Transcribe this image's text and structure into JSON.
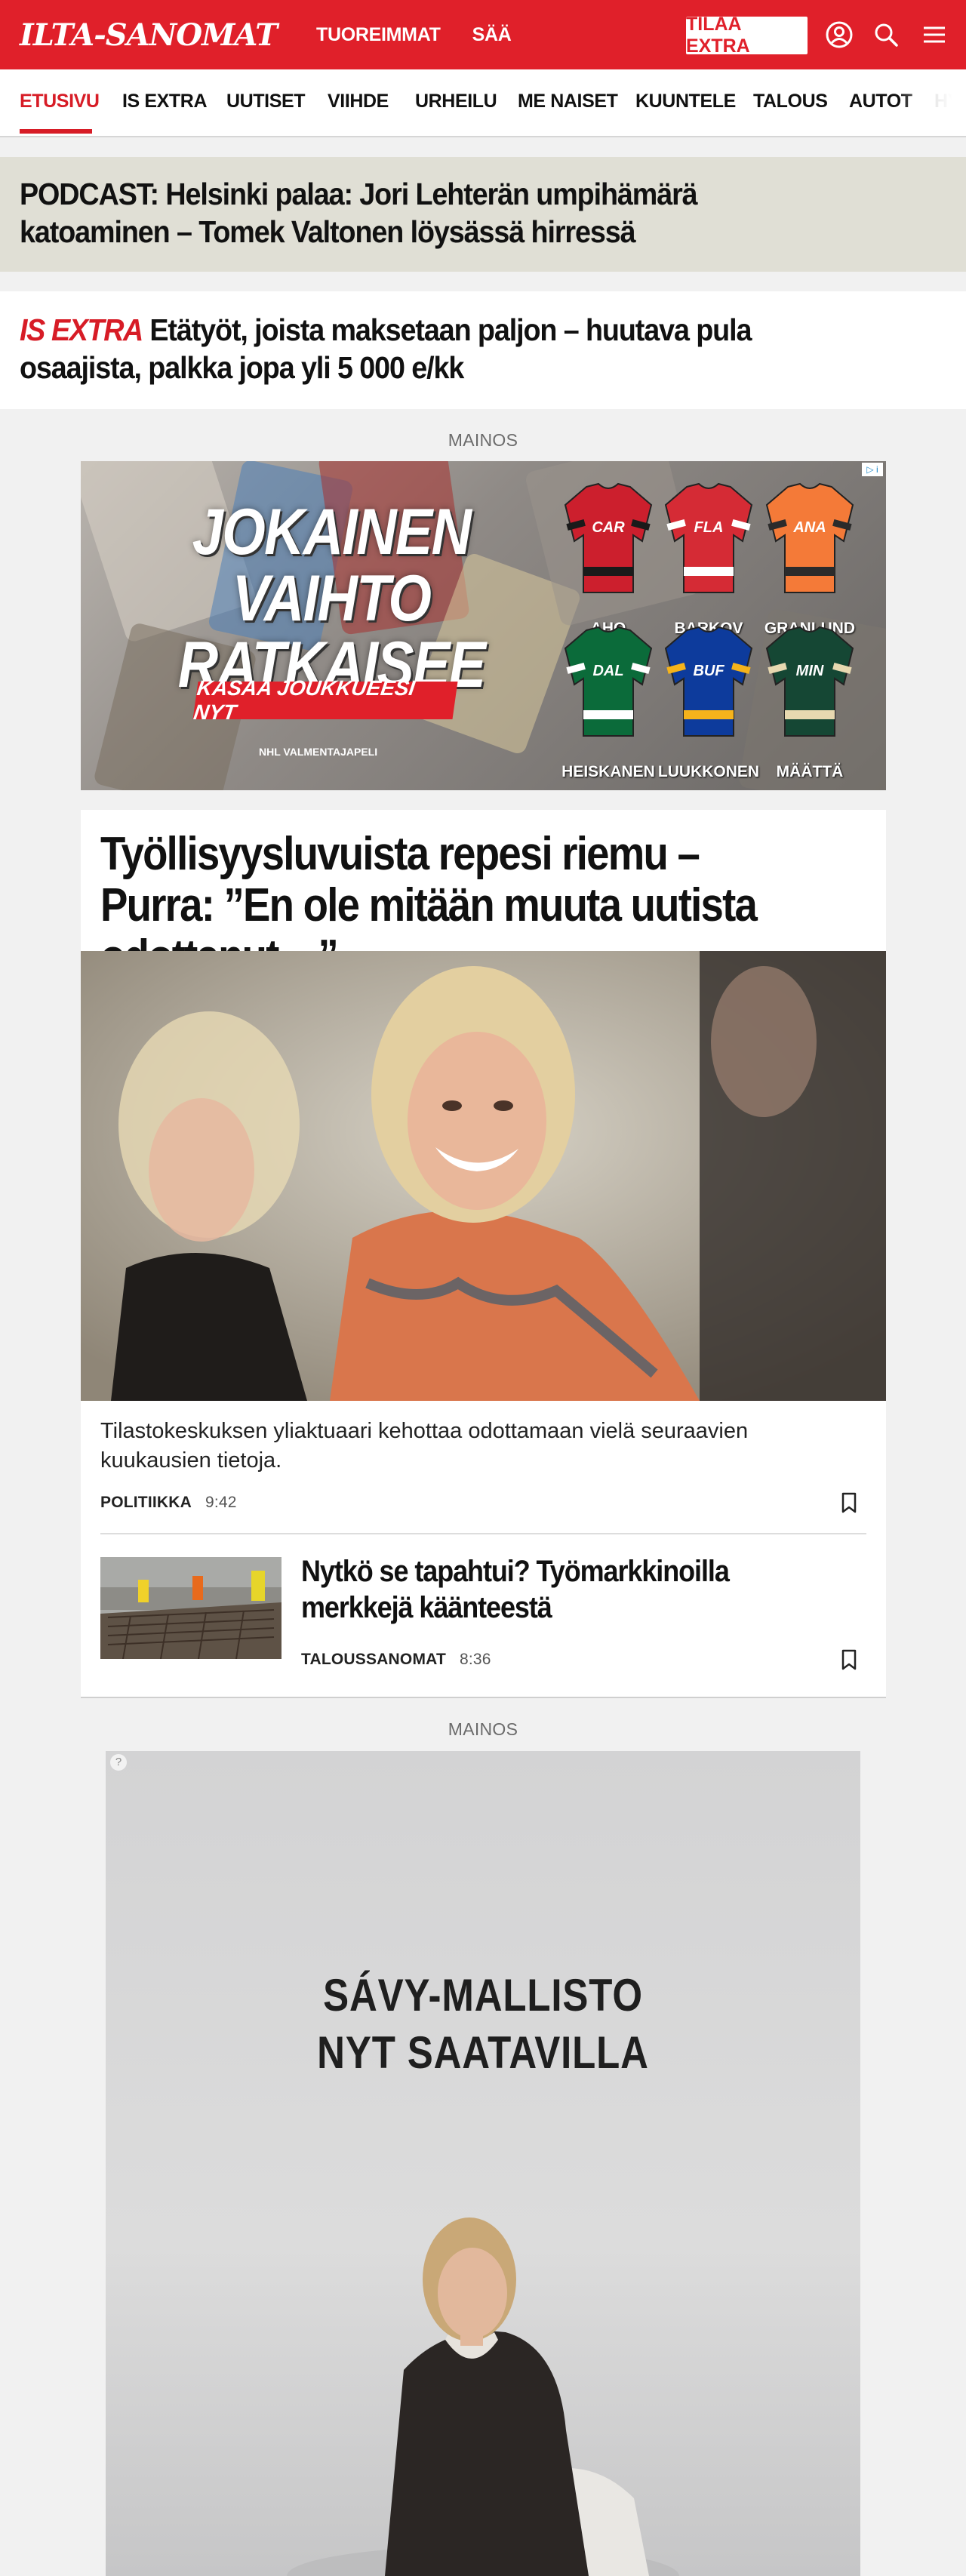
{
  "header": {
    "logo": "ILTA-SANOMAT",
    "links": [
      "TUOREIMMAT",
      "SÄÄ"
    ],
    "cta": "TILAA EXTRA",
    "icons": [
      "user-icon",
      "search-icon",
      "menu-icon"
    ],
    "brand_color": "#e0202a"
  },
  "nav": {
    "items": [
      "ETUSIVU",
      "IS EXTRA",
      "UUTISET",
      "VIIHDE",
      "URHEILU",
      "ME NAISET",
      "KUUNTELE",
      "TALOUS",
      "AUTOT",
      "HY"
    ],
    "active": "ETUSIVU"
  },
  "teasers": {
    "podcast": "PODCAST: Helsinki palaa: Jori Lehterän umpihämärä katoaminen – Tomek Valtonen löysässä hirressä",
    "isextra_tag": "IS EXTRA",
    "isextra_text": "Etätyöt, joista maksetaan paljon – huutava pula osaajista, palkka jopa yli 5 000 e/kk"
  },
  "ads": {
    "label": "MAINOS",
    "hockey": {
      "title": "JOKAINEN VAIHTO RATKAISEE",
      "cta": "KASAA JOUKKUEESI NYT",
      "brand": "NHL  VALMENTAJAPELI",
      "jerseys": [
        {
          "team": "CAR",
          "player": "AHO",
          "color": "#cc1f2d",
          "trim": "#1a1a1a"
        },
        {
          "team": "FLA",
          "player": "BARKOV",
          "color": "#d52b35",
          "trim": "#ffffff"
        },
        {
          "team": "ANA",
          "player": "GRANLUND",
          "color": "#f47a38",
          "trim": "#2b2b2b"
        },
        {
          "team": "DAL",
          "player": "HEISKANEN",
          "color": "#0b6b3a",
          "trim": "#ffffff"
        },
        {
          "team": "BUF",
          "player": "LUUKKONEN",
          "color": "#0d3b9c",
          "trim": "#f5b31b"
        },
        {
          "team": "MIN",
          "player": "MÄÄTTÄ",
          "color": "#154734",
          "trim": "#e7d8b0"
        }
      ]
    },
    "savy": {
      "title_line1": "SÁVY-MALLISTO",
      "title_line2": "NYT SAATAVILLA"
    }
  },
  "main_article": {
    "headline": "Työllisyysluvuista repesi riemu – Purra: ”En ole mitään muuta uutista odottanut…”",
    "lead": "Tilastokeskuksen yliaktuaari kehottaa odottamaan vielä seuraavien kuukausien tietoja.",
    "section": "POLITIIKKA",
    "time": "9:42"
  },
  "related_article": {
    "headline": "Nytkö se tapahtui? Työmarkkinoilla merkkejä käänteestä",
    "section": "TALOUSSANOMAT",
    "time": "8:36"
  }
}
